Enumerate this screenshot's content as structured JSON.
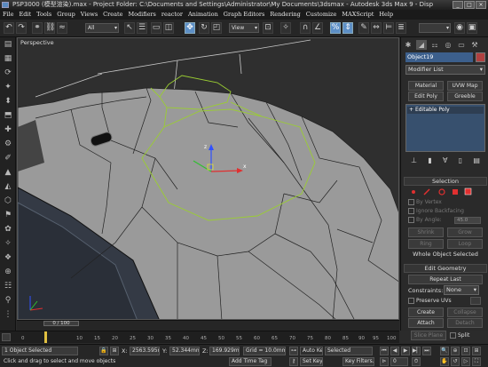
{
  "window": {
    "title": "PSP3000 (模型渲染).max  - Project Folder: C:\\Documents and Settings\\Administrator\\My Documents\\3dsmax  - Autodesk 3ds Max 9  - Disp"
  },
  "menubar": {
    "items": [
      "File",
      "Edit",
      "Tools",
      "Group",
      "Views",
      "Create",
      "Modifiers",
      "reactor",
      "Animation",
      "Graph Editors",
      "Rendering",
      "Customize",
      "MAXScript",
      "Help"
    ]
  },
  "toolbar": {
    "selection_filter": "All",
    "reference_coord": "View",
    "named_selection": ""
  },
  "viewport": {
    "label": "Perspective"
  },
  "command_panel": {
    "object_name": "Object19",
    "object_color": "#b04040",
    "modifier_list": "Modifier List",
    "buttons": [
      "Material",
      "UVW Map",
      "Edit Poly",
      "Greeble"
    ],
    "stack_item": "Editable Poly",
    "selection": {
      "header": "Selection",
      "by_vertex": "By Vertex",
      "ignore_backfacing": "Ignore Backfacing",
      "by_angle": "By Angle:",
      "by_angle_value": "45.0",
      "shrink": "Shrink",
      "grow": "Grow",
      "ring": "Ring",
      "loop": "Loop",
      "status": "Whole Object Selected"
    },
    "edit_geometry": {
      "header": "Edit Geometry",
      "repeat_last": "Repeat Last",
      "constraints_label": "Constraints:",
      "constraints_value": "None",
      "preserve_uvs": "Preserve UVs",
      "create": "Create",
      "collapse": "Collapse",
      "attach": "Attach",
      "detach": "Detach",
      "slice_plane": "Slice Plane",
      "split": "Split"
    }
  },
  "timeline": {
    "frame": "0 / 100",
    "ticks": [
      "0",
      "10",
      "15",
      "20",
      "25",
      "30",
      "35",
      "40",
      "45",
      "50",
      "55",
      "60",
      "65",
      "70",
      "75",
      "80",
      "85",
      "90",
      "95",
      "100"
    ]
  },
  "statusbar": {
    "selection_status": "1 Object Selected",
    "prompt": "Click and drag to select and move objects",
    "x_label": "X:",
    "x_value": "2563.595n",
    "y_label": "Y:",
    "y_value": "52.344mm",
    "z_label": "Z:",
    "z_value": "169.929m",
    "grid": "Grid = 10.0mm",
    "add_time_tag": "Add Time Tag",
    "auto_key": "Auto Key",
    "auto_key_mode": "Selected",
    "set_key": "Set Key",
    "key_filters": "Key Filters...",
    "current_frame": "0"
  },
  "colors": {
    "selection_highlight": "#5d8fc6",
    "wire_selected": "#9acd32",
    "gizmo_x": "#e03030",
    "gizmo_y": "#30c030",
    "gizmo_z": "#3050ff"
  }
}
